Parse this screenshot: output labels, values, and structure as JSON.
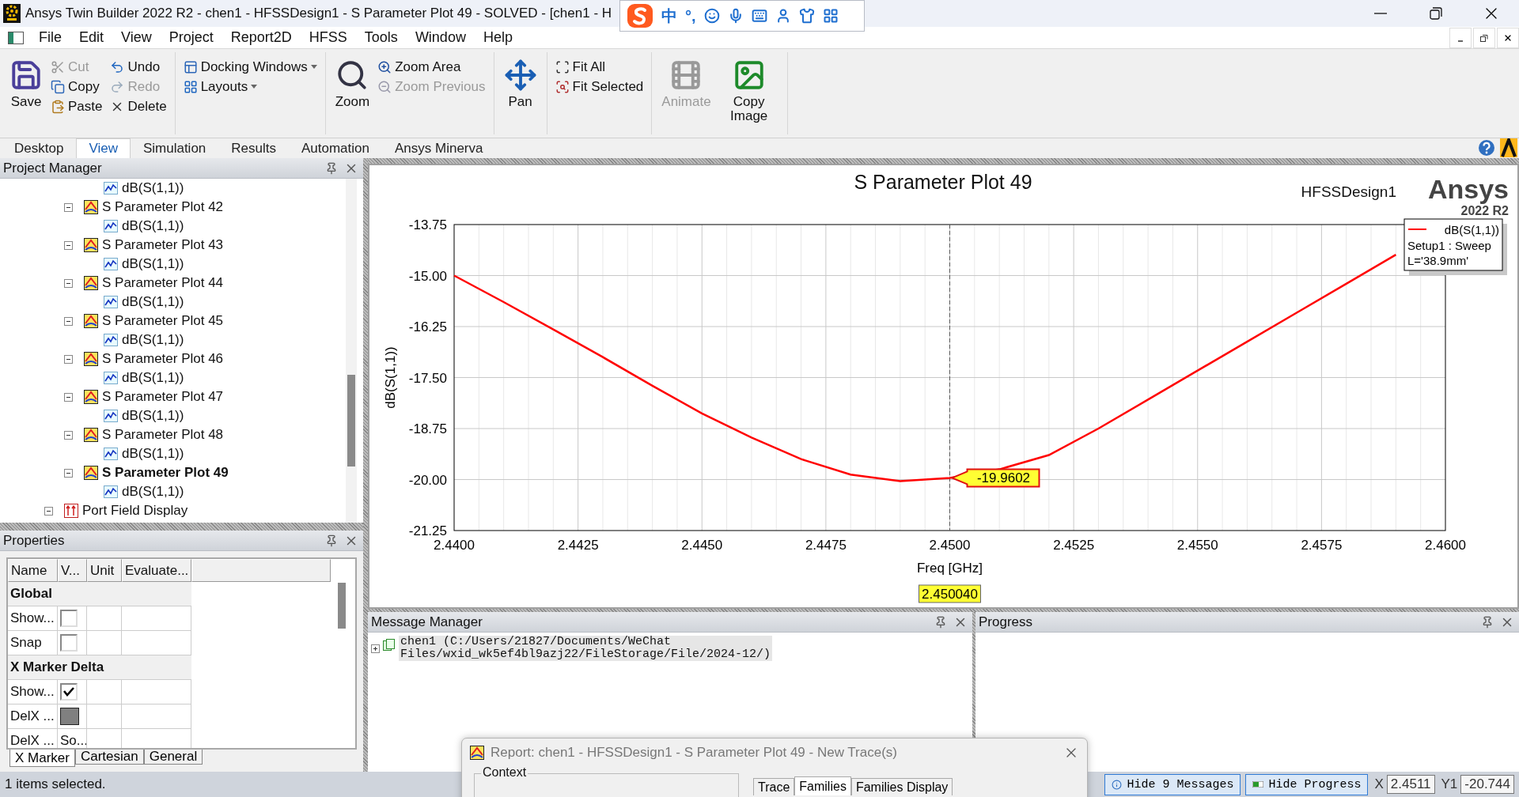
{
  "title_bar": {
    "title": "Ansys Twin Builder 2022 R2 - chen1 - HFSSDesign1 - S Parameter Plot 49 - SOLVED - [chen1 - H"
  },
  "ime_toolbar": [
    {
      "kind": "logo"
    },
    {
      "kind": "text",
      "label": "中"
    },
    {
      "kind": "text",
      "label": "°,"
    },
    {
      "kind": "icon"
    },
    {
      "kind": "icon"
    },
    {
      "kind": "icon"
    },
    {
      "kind": "icon"
    },
    {
      "kind": "icon"
    },
    {
      "kind": "icon"
    }
  ],
  "menu": [
    "File",
    "Edit",
    "View",
    "Project",
    "Report2D",
    "HFSS",
    "Tools",
    "Window",
    "Help"
  ],
  "ribbon": {
    "groups": [
      {
        "items": [
          {
            "label": "Save",
            "kind": "large",
            "disabled": false
          },
          {
            "label": "Cut",
            "kind": "small",
            "disabled": true
          },
          {
            "label": "Copy",
            "kind": "small",
            "disabled": false
          },
          {
            "label": "Paste",
            "kind": "small",
            "disabled": false
          },
          {
            "label": "Undo",
            "kind": "small",
            "disabled": false
          },
          {
            "label": "Redo",
            "kind": "small",
            "disabled": true
          },
          {
            "label": "Delete",
            "kind": "small",
            "disabled": false
          }
        ]
      },
      {
        "items": [
          {
            "label": "Docking Windows",
            "kind": "small",
            "disabled": false,
            "dropdown": true
          },
          {
            "label": "Layouts",
            "kind": "small",
            "disabled": false,
            "dropdown": true
          }
        ]
      },
      {
        "items": [
          {
            "label": "Zoom",
            "kind": "large",
            "disabled": false
          },
          {
            "label": "Zoom Area",
            "kind": "small",
            "disabled": false
          },
          {
            "label": "Zoom Previous",
            "kind": "small",
            "disabled": true
          }
        ]
      },
      {
        "items": [
          {
            "label": "Pan",
            "kind": "large",
            "disabled": false
          }
        ]
      },
      {
        "items": [
          {
            "label": "Fit All",
            "kind": "small",
            "disabled": false
          },
          {
            "label": "Fit Selected",
            "kind": "small",
            "disabled": false
          }
        ]
      },
      {
        "items": [
          {
            "label": "Animate",
            "kind": "large",
            "disabled": true
          },
          {
            "label": "Copy Image",
            "kind": "large",
            "disabled": false
          }
        ]
      }
    ]
  },
  "ribbon_tabs": [
    {
      "label": "Desktop",
      "selected": false
    },
    {
      "label": "View",
      "selected": true
    },
    {
      "label": "Simulation",
      "selected": false
    },
    {
      "label": "Results",
      "selected": false
    },
    {
      "label": "Automation",
      "selected": false
    },
    {
      "label": "Ansys Minerva",
      "selected": false
    }
  ],
  "project_manager": {
    "title": "Project Manager",
    "tree": [
      {
        "kind": "trace",
        "label": "dB(S(1,1))"
      },
      {
        "kind": "plot",
        "label": "S Parameter Plot 42",
        "expanded": true,
        "selected": false,
        "children": [
          {
            "kind": "trace",
            "label": "dB(S(1,1))"
          }
        ]
      },
      {
        "kind": "plot",
        "label": "S Parameter Plot 43",
        "expanded": true,
        "selected": false,
        "children": [
          {
            "kind": "trace",
            "label": "dB(S(1,1))"
          }
        ]
      },
      {
        "kind": "plot",
        "label": "S Parameter Plot 44",
        "expanded": true,
        "selected": false,
        "children": [
          {
            "kind": "trace",
            "label": "dB(S(1,1))"
          }
        ]
      },
      {
        "kind": "plot",
        "label": "S Parameter Plot 45",
        "expanded": true,
        "selected": false,
        "children": [
          {
            "kind": "trace",
            "label": "dB(S(1,1))"
          }
        ]
      },
      {
        "kind": "plot",
        "label": "S Parameter Plot 46",
        "expanded": true,
        "selected": false,
        "children": [
          {
            "kind": "trace",
            "label": "dB(S(1,1))"
          }
        ]
      },
      {
        "kind": "plot",
        "label": "S Parameter Plot 47",
        "expanded": true,
        "selected": false,
        "children": [
          {
            "kind": "trace",
            "label": "dB(S(1,1))"
          }
        ]
      },
      {
        "kind": "plot",
        "label": "S Parameter Plot 48",
        "expanded": true,
        "selected": false,
        "children": [
          {
            "kind": "trace",
            "label": "dB(S(1,1))"
          }
        ]
      },
      {
        "kind": "plot",
        "label": "S Parameter Plot 49",
        "expanded": true,
        "selected": true,
        "children": [
          {
            "kind": "trace",
            "label": "dB(S(1,1))"
          }
        ]
      },
      {
        "kind": "folder",
        "label": "Port Field Display",
        "expanded": true,
        "selected": false
      }
    ]
  },
  "properties": {
    "title": "Properties",
    "columns": [
      "Name",
      "V...",
      "Unit",
      "Evaluate..."
    ],
    "rows": [
      {
        "kind": "group",
        "label": "Global"
      },
      {
        "kind": "check",
        "name": "Show...",
        "checked": false
      },
      {
        "kind": "check",
        "name": "Snap",
        "checked": false
      },
      {
        "kind": "group",
        "label": "X Marker Delta"
      },
      {
        "kind": "check",
        "name": "Show...",
        "checked": true
      },
      {
        "kind": "color",
        "name": "DelX ...",
        "color": "#808080"
      },
      {
        "kind": "text",
        "name": "DelX ...",
        "value": "So..."
      }
    ],
    "tabs": [
      {
        "label": "X Marker",
        "selected": true
      },
      {
        "label": "Cartesian",
        "selected": false
      },
      {
        "label": "General",
        "selected": false
      }
    ]
  },
  "plot": {
    "design": "HFSSDesign1",
    "brand": "Ansys",
    "version": "2022 R2",
    "legend": [
      "Setup1 : Sweep",
      "L='38.9mm'"
    ],
    "x_marker": "2.450040",
    "chart_data": {
      "type": "line",
      "title": "S Parameter Plot 49",
      "xlabel": "Freq [GHz]",
      "ylabel": "dB(S(1,1))",
      "grid": true,
      "x": [
        2.44,
        2.441,
        2.442,
        2.443,
        2.444,
        2.445,
        2.446,
        2.447,
        2.448,
        2.449,
        2.45,
        2.451,
        2.452,
        2.453,
        2.454,
        2.455,
        2.456,
        2.457,
        2.458,
        2.459
      ],
      "series": [
        {
          "name": "dB(S(1,1))",
          "color": "#ff0000",
          "values": [
            -15.0,
            -15.65,
            -16.32,
            -17.0,
            -17.7,
            -18.38,
            -18.97,
            -19.5,
            -19.88,
            -20.04,
            -19.96,
            -19.75,
            -19.4,
            -18.75,
            -18.04,
            -17.33,
            -16.62,
            -15.91,
            -15.2,
            -14.49
          ]
        }
      ],
      "xlim": [
        2.44,
        2.46
      ],
      "ylim": [
        -21.25,
        -13.75
      ],
      "xticks": [
        {
          "value": 2.44,
          "label": "2.4400"
        },
        {
          "value": 2.4425,
          "label": "2.4425"
        },
        {
          "value": 2.445,
          "label": "2.4450"
        },
        {
          "value": 2.4475,
          "label": "2.4475"
        },
        {
          "value": 2.45,
          "label": "2.4500"
        },
        {
          "value": 2.4525,
          "label": "2.4525"
        },
        {
          "value": 2.455,
          "label": "2.4550"
        },
        {
          "value": 2.4575,
          "label": "2.4575"
        },
        {
          "value": 2.46,
          "label": "2.4600"
        }
      ],
      "yticks": [
        {
          "value": -13.75,
          "label": "-13.75"
        },
        {
          "value": -15,
          "label": "-15.00"
        },
        {
          "value": -16.25,
          "label": "-16.25"
        },
        {
          "value": -17.5,
          "label": "-17.50"
        },
        {
          "value": -18.75,
          "label": "-18.75"
        },
        {
          "value": -20,
          "label": "-20.00"
        },
        {
          "value": -21.25,
          "label": "-21.25"
        }
      ],
      "ref_lines": [
        {
          "axis": "x",
          "value": 2.45
        }
      ],
      "annotations": [
        {
          "x": 2.45,
          "y": -19.9602,
          "text": "-19.9602"
        }
      ]
    }
  },
  "message_manager": {
    "title": "Message Manager",
    "messages": [
      {
        "text": "chen1 (C:/Users/21827/Documents/WeChat\nFiles/wxid_wk5ef4bl9azj22/FileStorage/File/2024-12/)",
        "expanded": false
      }
    ]
  },
  "progress": {
    "title": "Progress"
  },
  "status_bar": {
    "text": "1 items selected.",
    "buttons": [
      {
        "label": "Hide 9 Messages",
        "kind": "info"
      },
      {
        "label": "Hide Progress",
        "kind": "progress"
      }
    ],
    "x_label": "X",
    "x_value": "2.4511",
    "y_label": "Y1",
    "y_value": "-20.744"
  },
  "dialog": {
    "title": "Report: chen1 - HFSSDesign1 - S Parameter Plot 49 - New Trace(s)",
    "context_label": "Context",
    "tabs": [
      {
        "label": "Trace",
        "selected": false
      },
      {
        "label": "Families",
        "selected": true
      },
      {
        "label": "Families Display",
        "selected": false
      }
    ]
  }
}
